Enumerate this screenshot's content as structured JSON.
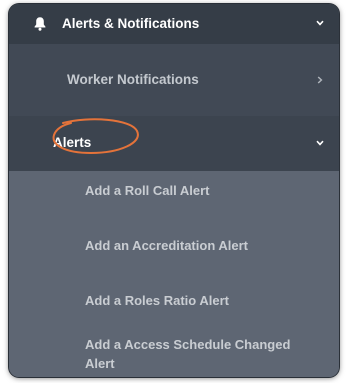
{
  "menu": {
    "section_title": "Alerts & Notifications",
    "section_icon": "bell-icon",
    "worker_notifications": "Worker Notifications",
    "alerts": "Alerts",
    "alert_items": [
      "Add a Roll Call Alert",
      "Add an Accreditation Alert",
      "Add a Roles Ratio Alert",
      "Add a Access Schedule Changed Alert"
    ]
  },
  "colors": {
    "highlight_circle": "#e4733a",
    "menu_bg": "#5e6673",
    "header_bg": "#353d47"
  }
}
